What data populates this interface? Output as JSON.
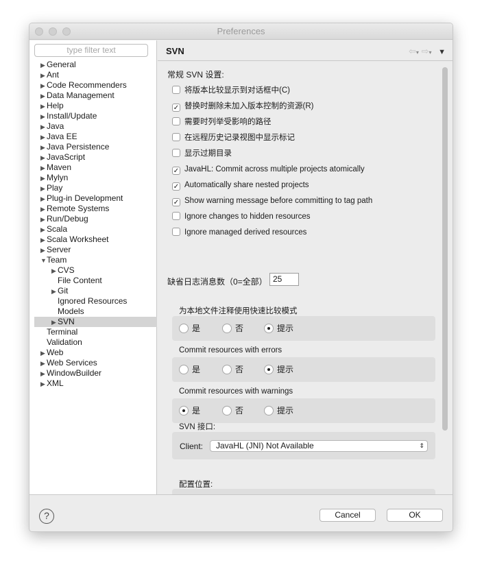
{
  "window": {
    "title": "Preferences"
  },
  "filter": {
    "placeholder": "type filter text"
  },
  "tree": [
    {
      "label": "General",
      "arrow": true,
      "level": 0
    },
    {
      "label": "Ant",
      "arrow": true,
      "level": 0
    },
    {
      "label": "Code Recommenders",
      "arrow": true,
      "level": 0
    },
    {
      "label": "Data Management",
      "arrow": true,
      "level": 0
    },
    {
      "label": "Help",
      "arrow": true,
      "level": 0
    },
    {
      "label": "Install/Update",
      "arrow": true,
      "level": 0
    },
    {
      "label": "Java",
      "arrow": true,
      "level": 0
    },
    {
      "label": "Java EE",
      "arrow": true,
      "level": 0
    },
    {
      "label": "Java Persistence",
      "arrow": true,
      "level": 0
    },
    {
      "label": "JavaScript",
      "arrow": true,
      "level": 0
    },
    {
      "label": "Maven",
      "arrow": true,
      "level": 0
    },
    {
      "label": "Mylyn",
      "arrow": true,
      "level": 0
    },
    {
      "label": "Play",
      "arrow": true,
      "level": 0
    },
    {
      "label": "Plug-in Development",
      "arrow": true,
      "level": 0
    },
    {
      "label": "Remote Systems",
      "arrow": true,
      "level": 0
    },
    {
      "label": "Run/Debug",
      "arrow": true,
      "level": 0
    },
    {
      "label": "Scala",
      "arrow": true,
      "level": 0
    },
    {
      "label": "Scala Worksheet",
      "arrow": true,
      "level": 0
    },
    {
      "label": "Server",
      "arrow": true,
      "level": 0
    },
    {
      "label": "Team",
      "arrow": true,
      "expanded": true,
      "level": 0
    },
    {
      "label": "CVS",
      "arrow": true,
      "level": 1
    },
    {
      "label": "File Content",
      "arrow": false,
      "level": 1
    },
    {
      "label": "Git",
      "arrow": true,
      "level": 1
    },
    {
      "label": "Ignored Resources",
      "arrow": false,
      "level": 1
    },
    {
      "label": "Models",
      "arrow": false,
      "level": 1
    },
    {
      "label": "SVN",
      "arrow": true,
      "level": 1,
      "selected": true
    },
    {
      "label": "Terminal",
      "arrow": false,
      "level": 0
    },
    {
      "label": "Validation",
      "arrow": false,
      "level": 0
    },
    {
      "label": "Web",
      "arrow": true,
      "level": 0
    },
    {
      "label": "Web Services",
      "arrow": true,
      "level": 0
    },
    {
      "label": "WindowBuilder",
      "arrow": true,
      "level": 0
    },
    {
      "label": "XML",
      "arrow": true,
      "level": 0
    }
  ],
  "page": {
    "title": "SVN",
    "general_label": "常规 SVN 设置:"
  },
  "checkboxes": [
    {
      "label": "将版本比较显示到对话框中(C)",
      "checked": false
    },
    {
      "label": "替换时删除未加入版本控制的资源(R)",
      "checked": true
    },
    {
      "label": "需要时列举受影响的路径",
      "checked": false
    },
    {
      "label": "在远程历史记录视图中显示标记",
      "checked": false
    },
    {
      "label": "显示过期目录",
      "checked": false
    },
    {
      "label": "JavaHL: Commit across multiple projects atomically",
      "checked": true
    },
    {
      "label": "Automatically share nested projects",
      "checked": true
    },
    {
      "label": "Show warning message before committing to tag path",
      "checked": true
    },
    {
      "label": "Ignore changes to hidden resources",
      "checked": false
    },
    {
      "label": "Ignore managed derived resources",
      "checked": false
    }
  ],
  "log_count": {
    "label": "缺省日志消息数（0=全部）",
    "value": "25"
  },
  "radio_groups": [
    {
      "label": "为本地文件注释使用快速比较模式",
      "options": [
        "是",
        "否",
        "提示"
      ],
      "selected": 2
    },
    {
      "label": "Commit resources with errors",
      "options": [
        "是",
        "否",
        "提示"
      ],
      "selected": 2
    },
    {
      "label": "Commit resources with warnings",
      "options": [
        "是",
        "否",
        "提示"
      ],
      "selected": 0
    }
  ],
  "svn_interface": {
    "label": "SVN 接口:",
    "client_label": "Client:",
    "client_value": "JavaHL (JNI) Not Available"
  },
  "config_location": {
    "label": "配置位置:"
  },
  "buttons": {
    "help": "?",
    "cancel": "Cancel",
    "ok": "OK"
  }
}
